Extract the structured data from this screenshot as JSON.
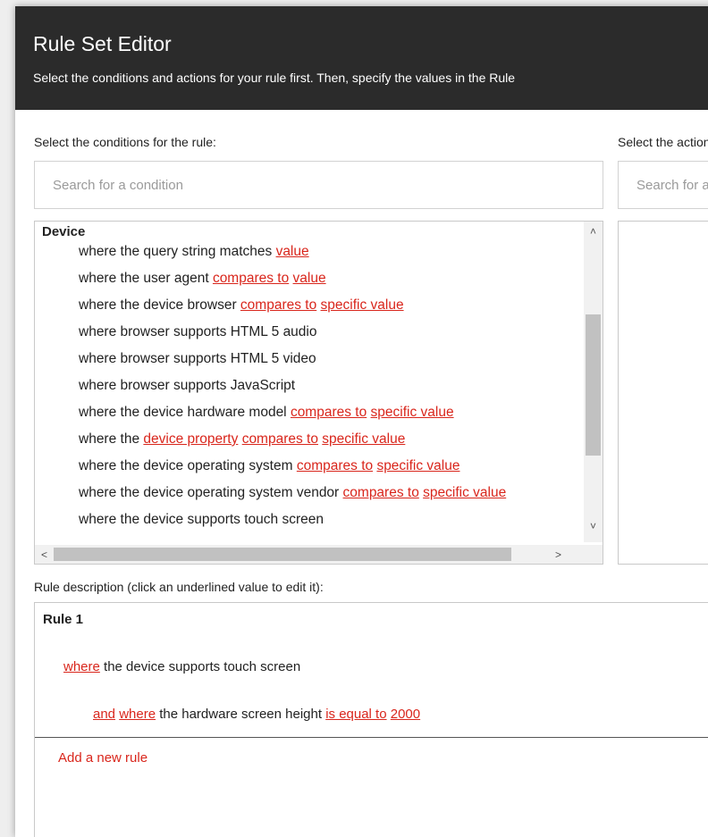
{
  "header": {
    "title": "Rule Set Editor",
    "subtitle": "Select the conditions and actions for your rule first. Then, specify the values in the Rule"
  },
  "conditions_panel": {
    "label": "Select the conditions for the rule:",
    "search_placeholder": "Search for a condition",
    "group_heading": "Device",
    "items": [
      {
        "pre": "where the query string matches ",
        "l1": "value",
        "mid": "",
        "l2": "",
        "post": ""
      },
      {
        "pre": "where the user agent ",
        "l1": "compares to",
        "mid": " ",
        "l2": "value",
        "post": ""
      },
      {
        "pre": "where the device browser ",
        "l1": "compares to",
        "mid": " ",
        "l2": "specific value",
        "post": ""
      },
      {
        "pre": "where browser supports HTML 5 audio",
        "l1": "",
        "mid": "",
        "l2": "",
        "post": ""
      },
      {
        "pre": "where browser supports HTML 5 video",
        "l1": "",
        "mid": "",
        "l2": "",
        "post": ""
      },
      {
        "pre": "where browser supports JavaScript",
        "l1": "",
        "mid": "",
        "l2": "",
        "post": ""
      },
      {
        "pre": "where the device hardware model ",
        "l1": "compares to",
        "mid": " ",
        "l2": "specific value",
        "post": ""
      },
      {
        "pre": "where the ",
        "l1": "device property",
        "mid": " ",
        "l2": "compares to",
        "post": " ",
        "l3": "specific value"
      },
      {
        "pre": "where the device operating system ",
        "l1": "compares to",
        "mid": " ",
        "l2": "specific value",
        "post": ""
      },
      {
        "pre": "where the device operating system vendor ",
        "l1": "compares to",
        "mid": " ",
        "l2": "specific value",
        "post": ""
      },
      {
        "pre": "where the device supports touch screen",
        "l1": "",
        "mid": "",
        "l2": "",
        "post": ""
      }
    ]
  },
  "actions_panel": {
    "label": "Select the actions for the rule:",
    "search_placeholder": "Search for an action"
  },
  "rule_description": {
    "label": "Rule description (click an underlined value to edit it):",
    "rule_title": "Rule 1",
    "line1": {
      "where": "where",
      "text": " the device supports touch screen"
    },
    "line2": {
      "and": "and",
      "sp1": " ",
      "where": "where",
      "text": " the hardware screen height ",
      "op": "is equal to",
      "sp2": " ",
      "value": "2000"
    },
    "add_rule": "Add a new rule"
  },
  "scroll_icons": {
    "up": "˄",
    "down": "˅",
    "left": "<",
    "right": ">"
  },
  "colors": {
    "header_bg": "#2b2b2b",
    "link": "#d9261c"
  }
}
